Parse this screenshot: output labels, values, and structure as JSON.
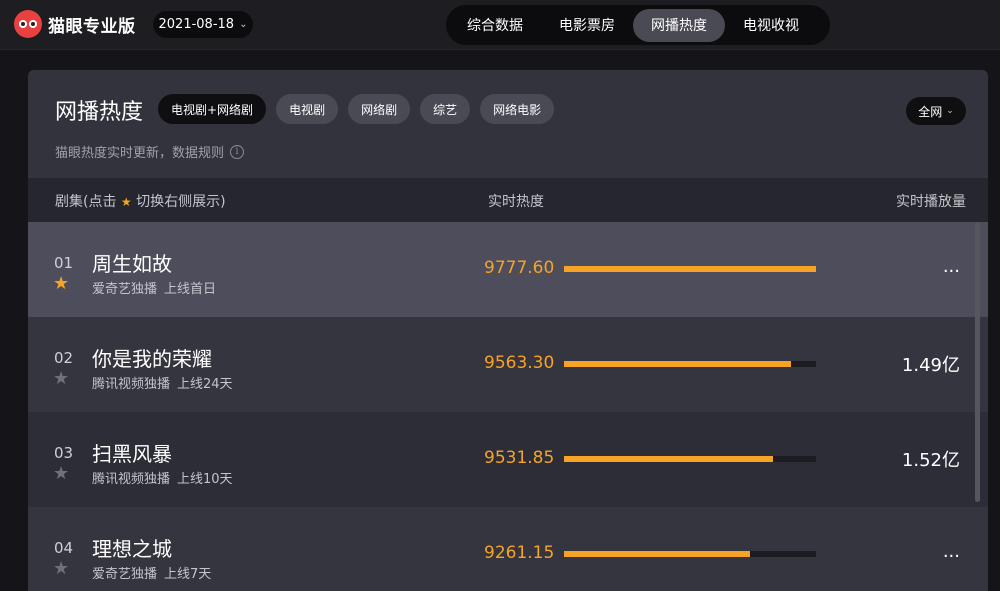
{
  "header": {
    "logo_text": "猫眼专业版",
    "date": "2021-08-18",
    "tabs": [
      "综合数据",
      "电影票房",
      "网播热度",
      "电视收视"
    ],
    "active_tab": 2
  },
  "panel": {
    "title": "网播热度",
    "chips": [
      "电视剧+网络剧",
      "电视剧",
      "网络剧",
      "综艺",
      "网络电影"
    ],
    "active_chip": 0,
    "scope": "全网",
    "subtitle": "猫眼热度实时更新，数据规则",
    "info_glyph": "i"
  },
  "table": {
    "col1_prefix": "剧集(点击",
    "col1_suffix": "切换右侧展示)",
    "col2": "实时热度",
    "col3": "实时播放量",
    "rows": [
      {
        "rank": "01",
        "name": "周生如故",
        "platform": "爱奇艺独播",
        "online": "上线首日",
        "score": "9777.60",
        "bar": 1.0,
        "plays": "...",
        "starred": true
      },
      {
        "rank": "02",
        "name": "你是我的荣耀",
        "platform": "腾讯视频独播",
        "online": "上线24天",
        "score": "9563.30",
        "bar": 0.9,
        "plays": "1.49亿",
        "starred": false
      },
      {
        "rank": "03",
        "name": "扫黑风暴",
        "platform": "腾讯视频独播",
        "online": "上线10天",
        "score": "9531.85",
        "bar": 0.83,
        "plays": "1.52亿",
        "starred": false
      },
      {
        "rank": "04",
        "name": "理想之城",
        "platform": "爱奇艺独播",
        "online": "上线7天",
        "score": "9261.15",
        "bar": 0.74,
        "plays": "...",
        "starred": false
      }
    ]
  },
  "colors": {
    "accent": "#f7a325",
    "logo_red": "#e8413f"
  }
}
